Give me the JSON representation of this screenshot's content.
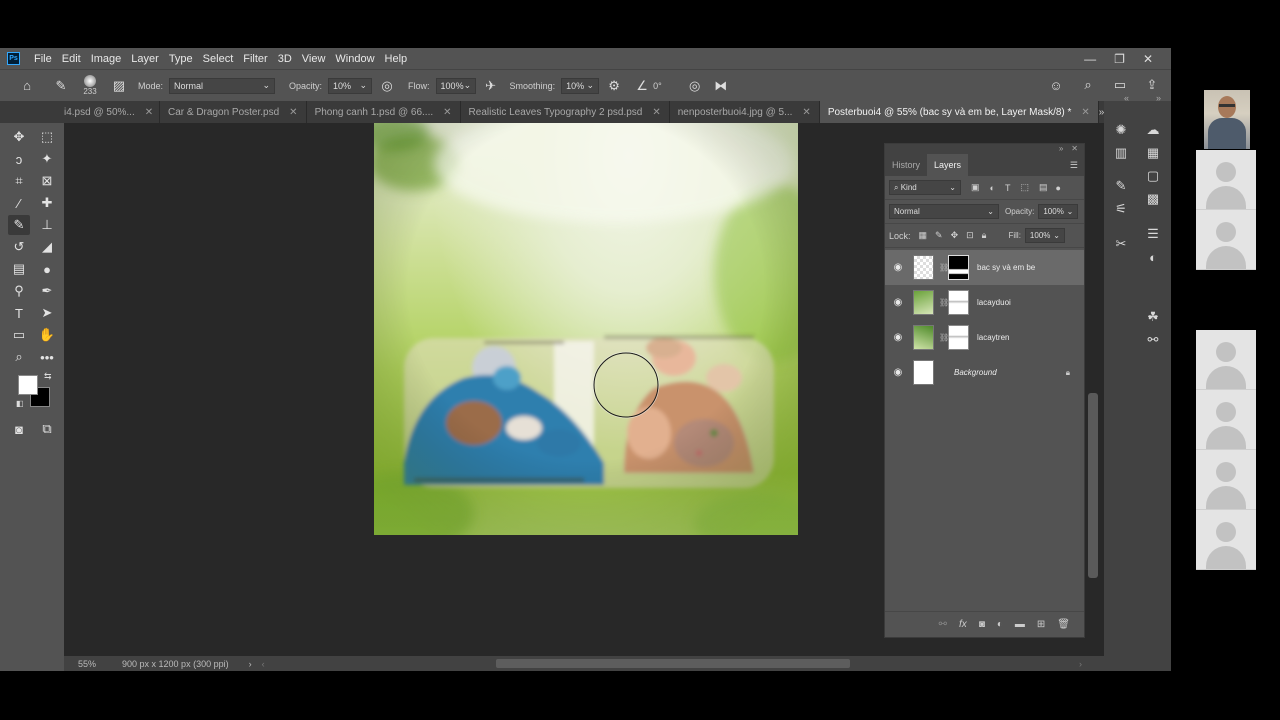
{
  "menubar": {
    "logo": "Ps",
    "items": [
      "File",
      "Edit",
      "Image",
      "Layer",
      "Type",
      "Select",
      "Filter",
      "3D",
      "View",
      "Window",
      "Help"
    ]
  },
  "options": {
    "brush_size": "233",
    "mode_label": "Mode:",
    "mode_value": "Normal",
    "opacity_label": "Opacity:",
    "opacity_value": "10%",
    "flow_label": "Flow:",
    "flow_value": "100%",
    "smoothing_label": "Smoothing:",
    "smoothing_value": "10%",
    "angle_value": "0°"
  },
  "tabs": [
    {
      "label": "i4.psd @ 50%...",
      "active": false
    },
    {
      "label": "Car & Dragon Poster.psd",
      "active": false
    },
    {
      "label": "Phong canh 1.psd @ 66....",
      "active": false
    },
    {
      "label": "Realistic Leaves Typography 2 psd.psd",
      "active": false
    },
    {
      "label": "nenposterbuoi4.jpg @ 5...",
      "active": false
    },
    {
      "label": "Posterbuoi4 @ 55% (bac sy và em be, Layer Mask/8) *",
      "active": true
    }
  ],
  "status": {
    "zoom": "55%",
    "doc_size": "900 px x 1200 px (300 ppi)"
  },
  "layers_panel": {
    "tabs": [
      "History",
      "Layers"
    ],
    "kind_label": "Kind",
    "blend_mode": "Normal",
    "opacity_label": "Opacity:",
    "opacity_value": "100%",
    "lock_label": "Lock:",
    "fill_label": "Fill:",
    "fill_value": "100%",
    "layers": [
      {
        "name": "bac sy và em be",
        "selected": true
      },
      {
        "name": "lacayduoi",
        "selected": false
      },
      {
        "name": "lacaytren",
        "selected": false
      },
      {
        "name": "Background",
        "selected": false
      }
    ]
  },
  "colors": {
    "accent": "#31a8ff",
    "panel_bg": "#535353",
    "canvas_bg": "#282828"
  }
}
